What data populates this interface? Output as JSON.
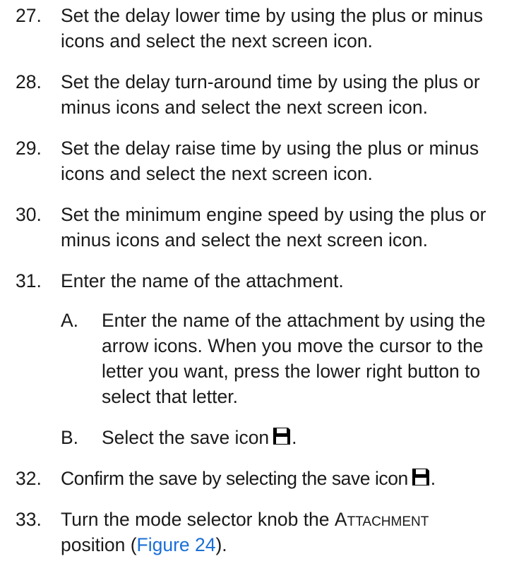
{
  "steps": [
    {
      "number": "27.",
      "text": "Set the delay lower time by using the plus or minus icons and select the next screen icon."
    },
    {
      "number": "28.",
      "text": "Set the delay turn-around time by using the plus or minus icons and select the next screen icon."
    },
    {
      "number": "29.",
      "text": "Set the delay raise time by using the plus or minus icons and select the next screen icon."
    },
    {
      "number": "30.",
      "text": "Set the minimum engine speed by using the plus or minus icons and select the next screen icon."
    },
    {
      "number": "31.",
      "text": "Enter the name of the attachment.",
      "substeps": [
        {
          "letter": "A.",
          "text": "Enter the name of the attachment by using the arrow icons. When you move the cursor to the letter you want, press the lower right button to select that letter."
        },
        {
          "letter": "B.",
          "text": "Select the save icon",
          "icon": "save-icon",
          "end": "."
        }
      ]
    },
    {
      "number": "32.",
      "text": "Confirm the save by selecting the save icon",
      "icon": "save-icon",
      "end": "."
    },
    {
      "number": "33.",
      "text_before": "Turn the mode selector knob the",
      "knob_position": "Attachment",
      "text_after": "position (",
      "link_text": "Figure 24",
      "text_end": ")."
    }
  ],
  "colors": {
    "text": "#1a1a1a",
    "link": "#1a6fd6",
    "icon": "#000000"
  }
}
